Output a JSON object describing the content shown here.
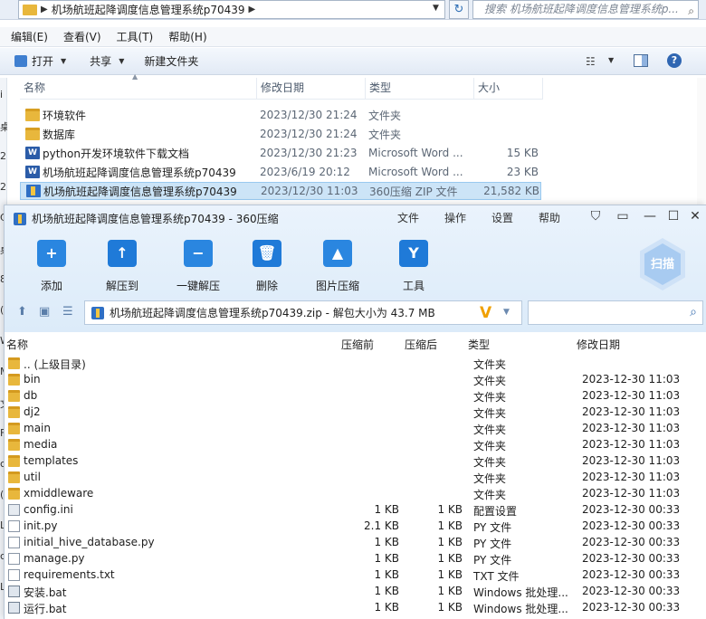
{
  "explorer": {
    "address_path": "机场航班起降调度信息管理系统p70439",
    "search_placeholder": "搜索 机场航班起降调度信息管理系统p...",
    "menu": [
      "编辑(E)",
      "查看(V)",
      "工具(T)",
      "帮助(H)"
    ],
    "toolbar": {
      "open": "打开",
      "share": "共享",
      "new_folder": "新建文件夹"
    },
    "columns": [
      "名称",
      "修改日期",
      "类型",
      "大小"
    ],
    "files": [
      {
        "name": "环境软件",
        "date": "2023/12/30 21:24",
        "type": "文件夹",
        "size": "",
        "icon": "folder-icon"
      },
      {
        "name": "数据库",
        "date": "2023/12/30 21:24",
        "type": "文件夹",
        "size": "",
        "icon": "folder-icon"
      },
      {
        "name": "python开发环境软件下载文档",
        "date": "2023/12/30 21:23",
        "type": "Microsoft Word ...",
        "size": "15 KB",
        "icon": "word-icon"
      },
      {
        "name": "机场航班起降调度信息管理系统p70439",
        "date": "2023/6/19 20:12",
        "type": "Microsoft Word ...",
        "size": "23 KB",
        "icon": "word-icon"
      },
      {
        "name": "机场航班起降调度信息管理系统p70439",
        "date": "2023/12/30 11:03",
        "type": "360压缩 ZIP 文件",
        "size": "21,582 KB",
        "icon": "zip-icon",
        "selected": true
      }
    ],
    "edge_chars": [
      "i",
      "桌",
      "2",
      "2",
      "C",
      "桌",
      "8",
      "(",
      "W",
      "M",
      "文",
      "F",
      "c",
      "(",
      "L",
      "c",
      "L"
    ]
  },
  "zip": {
    "title": "机场航班起降调度信息管理系统p70439 - 360压缩",
    "menu": [
      "文件",
      "操作",
      "设置",
      "帮助"
    ],
    "tools": [
      {
        "label": "添加",
        "icon": "add-icon"
      },
      {
        "label": "解压到",
        "icon": "extract-to-icon"
      },
      {
        "label": "一键解压",
        "icon": "one-click-extract-icon"
      },
      {
        "label": "删除",
        "icon": "delete-icon"
      },
      {
        "label": "图片压缩",
        "icon": "image-compress-icon"
      },
      {
        "label": "工具",
        "icon": "tools-icon"
      }
    ],
    "scan_label": "扫描",
    "path_text": "机场航班起降调度信息管理系统p70439.zip - 解包大小为 43.7 MB",
    "columns": {
      "name": "名称",
      "before": "压缩前",
      "after": "压缩后",
      "type": "类型",
      "modified": "修改日期"
    },
    "rows": [
      {
        "name": ".. (上级目录)",
        "before": "",
        "after": "",
        "type": "文件夹",
        "modified": "",
        "kind": "folder"
      },
      {
        "name": "bin",
        "before": "",
        "after": "",
        "type": "文件夹",
        "modified": "2023-12-30 11:03",
        "kind": "folder"
      },
      {
        "name": "db",
        "before": "",
        "after": "",
        "type": "文件夹",
        "modified": "2023-12-30 11:03",
        "kind": "folder"
      },
      {
        "name": "dj2",
        "before": "",
        "after": "",
        "type": "文件夹",
        "modified": "2023-12-30 11:03",
        "kind": "folder"
      },
      {
        "name": "main",
        "before": "",
        "after": "",
        "type": "文件夹",
        "modified": "2023-12-30 11:03",
        "kind": "folder"
      },
      {
        "name": "media",
        "before": "",
        "after": "",
        "type": "文件夹",
        "modified": "2023-12-30 11:03",
        "kind": "folder"
      },
      {
        "name": "templates",
        "before": "",
        "after": "",
        "type": "文件夹",
        "modified": "2023-12-30 11:03",
        "kind": "folder"
      },
      {
        "name": "util",
        "before": "",
        "after": "",
        "type": "文件夹",
        "modified": "2023-12-30 11:03",
        "kind": "folder"
      },
      {
        "name": "xmiddleware",
        "before": "",
        "after": "",
        "type": "文件夹",
        "modified": "2023-12-30 11:03",
        "kind": "folder"
      },
      {
        "name": "config.ini",
        "before": "1 KB",
        "after": "1 KB",
        "type": "配置设置",
        "modified": "2023-12-30 00:33",
        "kind": "config"
      },
      {
        "name": "init.py",
        "before": "2.1 KB",
        "after": "1 KB",
        "type": "PY 文件",
        "modified": "2023-12-30 00:33",
        "kind": "doc"
      },
      {
        "name": "initial_hive_database.py",
        "before": "1 KB",
        "after": "1 KB",
        "type": "PY 文件",
        "modified": "2023-12-30 00:33",
        "kind": "doc"
      },
      {
        "name": "manage.py",
        "before": "1 KB",
        "after": "1 KB",
        "type": "PY 文件",
        "modified": "2023-12-30 00:33",
        "kind": "doc"
      },
      {
        "name": "requirements.txt",
        "before": "1 KB",
        "after": "1 KB",
        "type": "TXT 文件",
        "modified": "2023-12-30 00:33",
        "kind": "doc"
      },
      {
        "name": "安装.bat",
        "before": "1 KB",
        "after": "1 KB",
        "type": "Windows 批处理...",
        "modified": "2023-12-30 00:33",
        "kind": "bat"
      },
      {
        "name": "运行.bat",
        "before": "1 KB",
        "after": "1 KB",
        "type": "Windows 批处理...",
        "modified": "2023-12-30 00:33",
        "kind": "bat"
      }
    ]
  }
}
